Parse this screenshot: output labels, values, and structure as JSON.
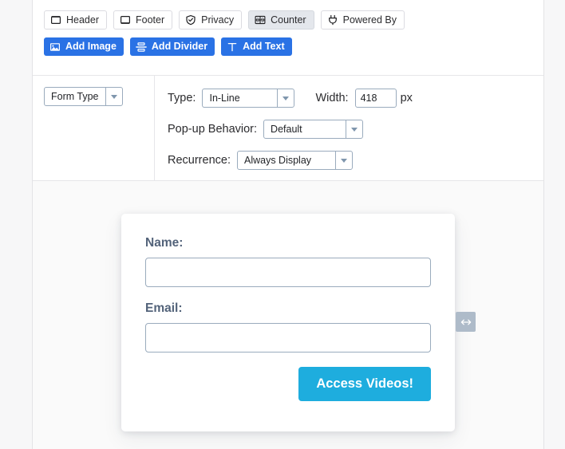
{
  "theme": {
    "primary_blue": "#2a72e5",
    "submit_cyan": "#1eadde",
    "label_slate": "#53637a",
    "chip_active_bg": "#e4e7ec",
    "panel_bg": "#ffffff",
    "preview_bg": "#fafafa",
    "handle_gray": "#aebbc9"
  },
  "toolbar": {
    "chips": [
      {
        "label": "Header",
        "icon": "header-icon",
        "active": false
      },
      {
        "label": "Footer",
        "icon": "footer-icon",
        "active": false
      },
      {
        "label": "Privacy",
        "icon": "shield-check-icon",
        "active": false
      },
      {
        "label": "Counter",
        "icon": "counter-icon",
        "active": true
      },
      {
        "label": "Powered By",
        "icon": "power-plug-icon",
        "active": false
      }
    ],
    "actions": [
      {
        "label": "Add Image",
        "icon": "image-icon"
      },
      {
        "label": "Add Divider",
        "icon": "divider-icon"
      },
      {
        "label": "Add Text",
        "icon": "text-t-icon"
      }
    ]
  },
  "settings": {
    "form_type": {
      "value": "Form Type",
      "options": [
        "Form Type"
      ]
    },
    "type": {
      "label": "Type:",
      "value": "In-Line",
      "options": [
        "In-Line"
      ]
    },
    "width": {
      "label": "Width:",
      "value": "418",
      "placeholder": "",
      "unit": "px"
    },
    "popup_behavior": {
      "label": "Pop-up Behavior:",
      "value": "Default",
      "options": [
        "Default"
      ]
    },
    "recurrence": {
      "label": "Recurrence:",
      "value": "Always Display",
      "options": [
        "Always Display"
      ]
    }
  },
  "preview": {
    "fields": [
      {
        "label": "Name:",
        "value": "",
        "placeholder": ""
      },
      {
        "label": "Email:",
        "value": "",
        "placeholder": ""
      }
    ],
    "submit_label": "Access Videos!",
    "resize_handle_icon": "horizontal-resize-icon"
  }
}
